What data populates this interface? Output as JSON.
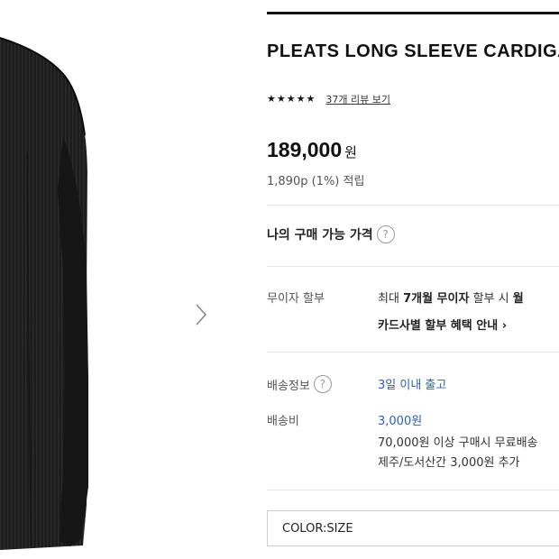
{
  "product": {
    "title": "PLEATS LONG SLEEVE CARDIGAN",
    "rating_stars": 5,
    "review_link": "37개 리뷰 보기",
    "price": "189,000",
    "price_unit": "원",
    "points": "1,890p (1%) 적립"
  },
  "my_price": {
    "label": "나의 구매 가능 가격",
    "help": "?"
  },
  "installment": {
    "label": "무이자 할부",
    "line1_prefix": "최대 ",
    "line1_bold": "7개월 무이자",
    "line1_mid": " 할부 시 ",
    "line1_tail": "월",
    "line2": "카드사별 할부 혜택 안내 ›"
  },
  "shipping": {
    "info_label": "배송정보",
    "info_help": "?",
    "info_value": "3일 이내 출고",
    "fee_label": "배송비",
    "fee_value": "3,000원",
    "fee_note1": "70,000원 이상 구매시 무료배송",
    "fee_note2": "제주/도서산간 3,000원 추가"
  },
  "option_select": {
    "label": "COLOR:SIZE"
  },
  "icons": {
    "next": "chevron-right-icon",
    "help": "question-circle-icon",
    "star": "star-icon"
  },
  "colors": {
    "accent_blue": "#2f5fb7",
    "garment": "#1d1d1d"
  }
}
